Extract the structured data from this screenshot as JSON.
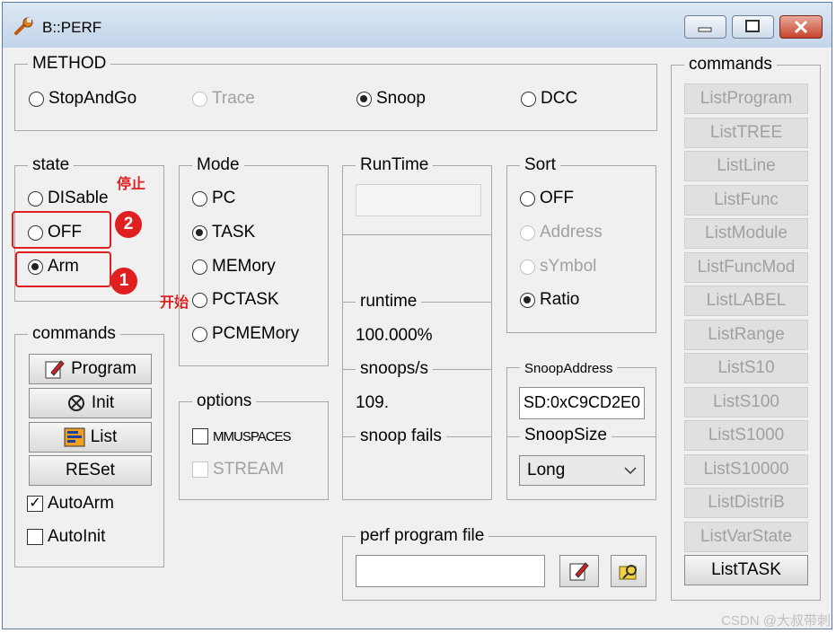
{
  "window": {
    "title": "B::PERF"
  },
  "method": {
    "legend": "METHOD",
    "options": [
      {
        "label": "StopAndGo",
        "selected": false,
        "enabled": true
      },
      {
        "label": "Trace",
        "selected": false,
        "enabled": false
      },
      {
        "label": "Snoop",
        "selected": true,
        "enabled": true
      },
      {
        "label": "DCC",
        "selected": false,
        "enabled": true
      }
    ]
  },
  "state": {
    "legend": "state",
    "options": [
      {
        "label": "DISable",
        "selected": false
      },
      {
        "label": "OFF",
        "selected": false
      },
      {
        "label": "Arm",
        "selected": true
      }
    ]
  },
  "annotations": {
    "stop": "停止",
    "start": "开始",
    "badge1": "1",
    "badge2": "2"
  },
  "left_commands": {
    "legend": "commands",
    "buttons": [
      "Program",
      "Init",
      "List",
      "RESet"
    ],
    "checks": [
      {
        "label": "AutoArm",
        "checked": true
      },
      {
        "label": "AutoInit",
        "checked": false
      }
    ]
  },
  "mode": {
    "legend": "Mode",
    "options": [
      {
        "label": "PC",
        "selected": false
      },
      {
        "label": "TASK",
        "selected": true
      },
      {
        "label": "MEMory",
        "selected": false
      },
      {
        "label": "PCTASK",
        "selected": false
      },
      {
        "label": "PCMEMory",
        "selected": false
      }
    ]
  },
  "options": {
    "legend": "options",
    "items": [
      {
        "label": "MMUSPACES",
        "checked": false,
        "enabled": true
      },
      {
        "label": "STREAM",
        "checked": false,
        "enabled": false
      }
    ]
  },
  "runtime": {
    "legend": "RunTime",
    "field_value": "",
    "runtime_label": "runtime",
    "runtime_value": "100.000%",
    "snoops_label": "snoops/s",
    "snoops_value": "109.",
    "fails_label": "snoop fails",
    "fails_value": ""
  },
  "sort": {
    "legend": "Sort",
    "options": [
      {
        "label": "OFF",
        "selected": false,
        "enabled": true
      },
      {
        "label": "Address",
        "selected": false,
        "enabled": false
      },
      {
        "label": "sYmbol",
        "selected": false,
        "enabled": false
      },
      {
        "label": "Ratio",
        "selected": true,
        "enabled": true
      }
    ]
  },
  "snoop": {
    "address_legend": "SnoopAddress",
    "address_value": "SD:0xC9CD2E0",
    "size_legend": "SnoopSize",
    "size_value": "Long"
  },
  "perf_file": {
    "legend": "perf program file",
    "value": ""
  },
  "right_commands": {
    "legend": "commands",
    "buttons": [
      {
        "label": "ListProgram",
        "enabled": false
      },
      {
        "label": "ListTREE",
        "enabled": false
      },
      {
        "label": "ListLine",
        "enabled": false
      },
      {
        "label": "ListFunc",
        "enabled": false
      },
      {
        "label": "ListModule",
        "enabled": false
      },
      {
        "label": "ListFuncMod",
        "enabled": false
      },
      {
        "label": "ListLABEL",
        "enabled": false
      },
      {
        "label": "ListRange",
        "enabled": false
      },
      {
        "label": "ListS10",
        "enabled": false
      },
      {
        "label": "ListS100",
        "enabled": false
      },
      {
        "label": "ListS1000",
        "enabled": false
      },
      {
        "label": "ListS10000",
        "enabled": false
      },
      {
        "label": "ListDistriB",
        "enabled": false
      },
      {
        "label": "ListVarState",
        "enabled": false
      },
      {
        "label": "ListTASK",
        "enabled": true
      }
    ]
  },
  "watermark": "CSDN @大叔带刺",
  "colors": {
    "accent_red": "#e02020",
    "disabled_text": "#a0a0a0",
    "window_bg": "#f0f0f0"
  }
}
